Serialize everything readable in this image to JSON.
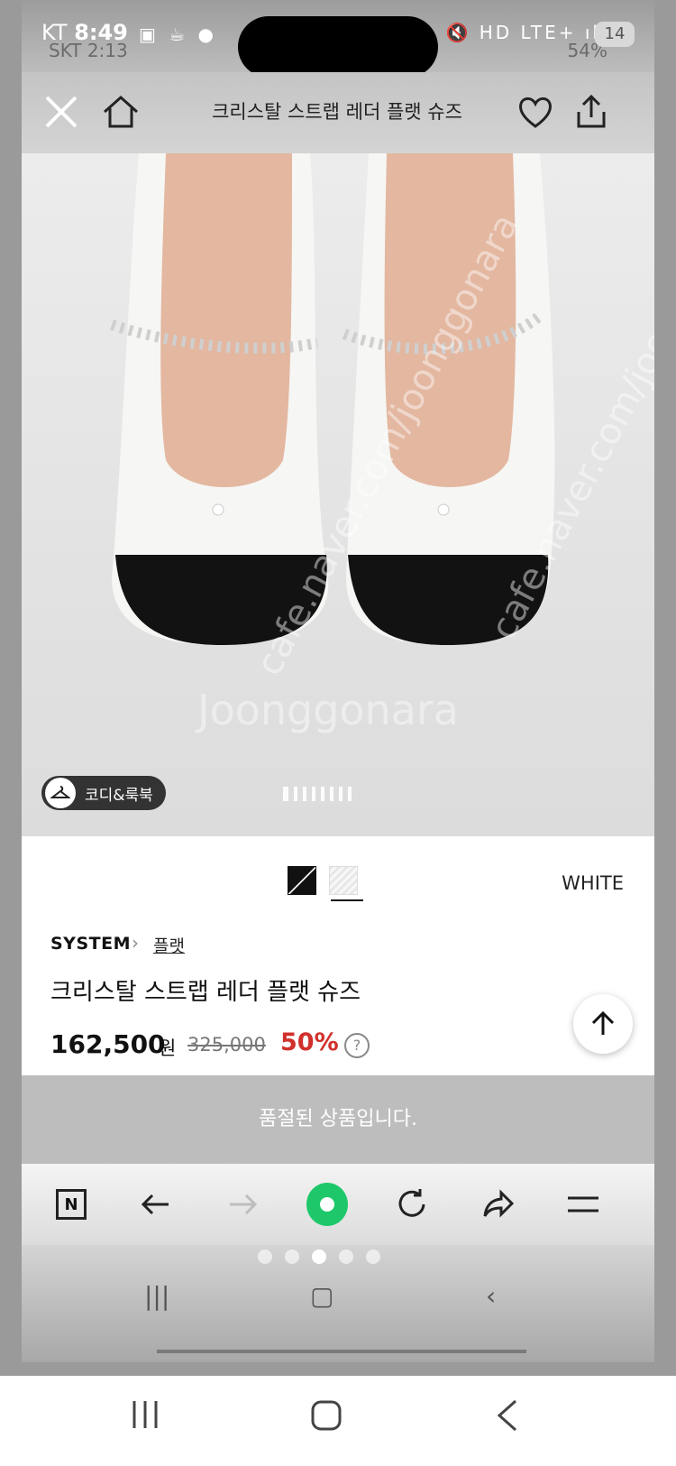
{
  "status": {
    "carrier": "KT",
    "time": "8:49",
    "ghost_carrier": "SKT 2:13",
    "ghost_battery": "54%",
    "network": "LTE+",
    "notifications": "14"
  },
  "header": {
    "title": "크리스탈 스트랩 레더 플랫 슈즈"
  },
  "hero": {
    "watermark": "Joonggonara",
    "watermark_side": "cafe.naver.com/joonggonara",
    "codi_label": "코디&룩북",
    "page_count": 8,
    "current_page": 1
  },
  "product": {
    "color_name": "WHITE",
    "brand": "SYSTEM",
    "category": "플랫",
    "name": "크리스탈 스트랩 레더 플랫 슈즈",
    "price": "162,500",
    "currency": "원",
    "original_price": "325,000",
    "discount": "50%",
    "help": "?"
  },
  "soldout": {
    "message": "품절된 상품입니다."
  },
  "browser": {
    "n_label": "N"
  },
  "colors": {
    "accent_green": "#1ec86a",
    "discount_red": "#d0302b",
    "soldout_bg": "#bdbdbd"
  }
}
